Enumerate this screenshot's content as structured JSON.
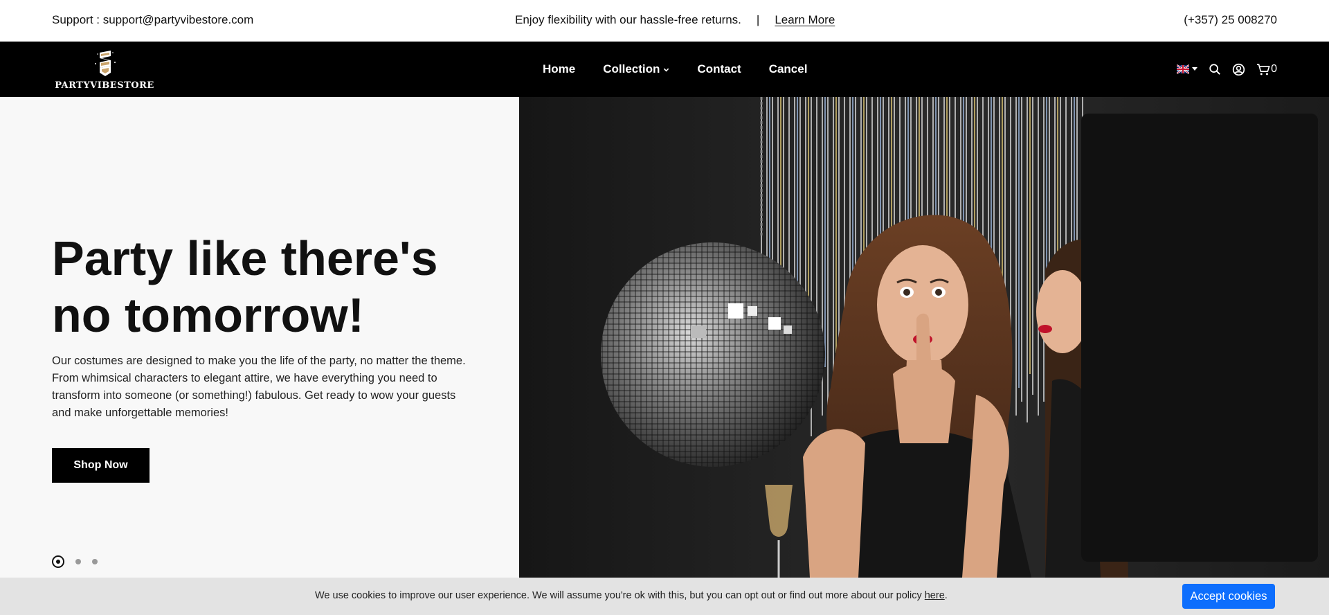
{
  "announcement": {
    "support": "Support : support@partyvibestore.com",
    "message": "Enjoy flexibility with our hassle-free returns.",
    "separator": "|",
    "link": "Learn More",
    "phone": "(+357) 25 008270"
  },
  "header": {
    "logo_text": "PARTYVIBESTORE",
    "nav": [
      {
        "label": "Home"
      },
      {
        "label": "Collection",
        "has_dropdown": true
      },
      {
        "label": "Contact"
      },
      {
        "label": "Cancel"
      }
    ],
    "cart_count": "0",
    "icons": [
      "uk-flag-icon",
      "chevron-down-icon",
      "search-icon",
      "account-icon",
      "cart-icon"
    ]
  },
  "hero": {
    "title": "Party like there's no tomorrow!",
    "text": "Our costumes are designed to make you the life of the party, no matter the theme. From whimsical characters to elegant attire, we have everything you need to transform into someone (or something!) fabulous. Get ready to wow your guests and make unforgettable memories!",
    "button": "Shop Now",
    "slides": 3,
    "active_slide": 1
  },
  "cookie": {
    "message": "We use cookies to improve our user experience. We will assume you're ok with this, but you can opt out or find out more about our policy ",
    "link": "here",
    "suffix": ".",
    "button": "Accept cookies"
  },
  "colors": {
    "header_bg": "#000000",
    "hero_left_bg": "#f8f8f8",
    "cookie_bg": "#e3e3e3",
    "accept_button": "#0d6efd",
    "lips": "#c0122a"
  }
}
